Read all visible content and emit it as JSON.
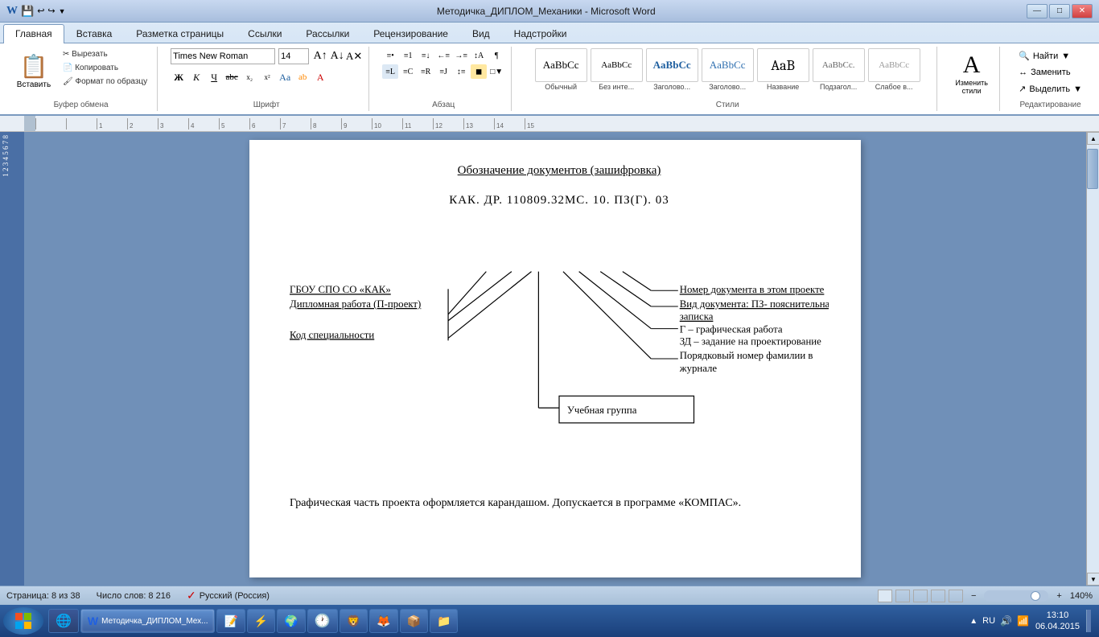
{
  "titlebar": {
    "title": "Методичка_ДИПЛОМ_Механики - Microsoft Word",
    "left_icons": [
      "💾",
      "↩",
      "↪",
      "▼"
    ],
    "min": "—",
    "max": "□",
    "close": "✕"
  },
  "ribbon": {
    "tabs": [
      "Главная",
      "Вставка",
      "Разметка страницы",
      "Ссылки",
      "Рассылки",
      "Рецензирование",
      "Вид",
      "Надстройки"
    ],
    "active_tab": "Главная",
    "clipboard": {
      "paste": "Вставить",
      "cut": "Вырезать",
      "copy": "Копировать",
      "format": "Формат по образцу"
    },
    "font": {
      "name": "Times New Roman",
      "size": "14",
      "bold": "Ж",
      "italic": "К",
      "underline": "Ч",
      "strikethrough": "abc",
      "subscript": "x₂",
      "superscript": "x²"
    },
    "styles": [
      {
        "label": "Обычный",
        "preview": "AaBbCс"
      },
      {
        "label": "Без инте...",
        "preview": "AaBbCс"
      },
      {
        "label": "Заголово...",
        "preview": "AaBbCс"
      },
      {
        "label": "Заголово...",
        "preview": "AaBbCс"
      },
      {
        "label": "Название",
        "preview": "AaB"
      },
      {
        "label": "Подзагол...",
        "preview": "AaBbCс."
      },
      {
        "label": "Слабое в...",
        "preview": "AaBbCс"
      }
    ],
    "editing": {
      "find": "Найти",
      "replace": "Заменить",
      "select": "Выделить"
    },
    "groups": [
      "Буфер обмена",
      "Шрифт",
      "Абзац",
      "Стили",
      "Редактирование"
    ]
  },
  "document": {
    "title": "Обозначение документов (зашифровка)",
    "code": "КАК. ДР. 110809.32МС. 10. ПЗ(Г). 03",
    "left_labels": [
      "ГБОУ СПО СО «КАК»",
      "Дипломная работа (П-проект)",
      "Код специальности"
    ],
    "right_labels": [
      "Номер документа в этом проекте",
      "Вид документа: ПЗ- пояснительная",
      "записка",
      "Г – графическая работа",
      "ЗД – задание на проектирование",
      "Порядковый номер фамилии в",
      "журнале"
    ],
    "uchebnaya": "Учебная группа",
    "footer_text": "Графическая часть проекта оформляется карандашом. Допускается в программе «КОМПАС»."
  },
  "statusbar": {
    "page": "Страница: 8 из 38",
    "words": "Число слов: 8 216",
    "language": "Русский (Россия)",
    "zoom": "140%"
  },
  "taskbar": {
    "items": [
      "Chrome",
      "Word",
      "Notepad",
      "KOMPAS",
      "Globe",
      "Firefox",
      "App"
    ],
    "time": "13:10",
    "date": "06.04.2015",
    "locale": "RU"
  }
}
